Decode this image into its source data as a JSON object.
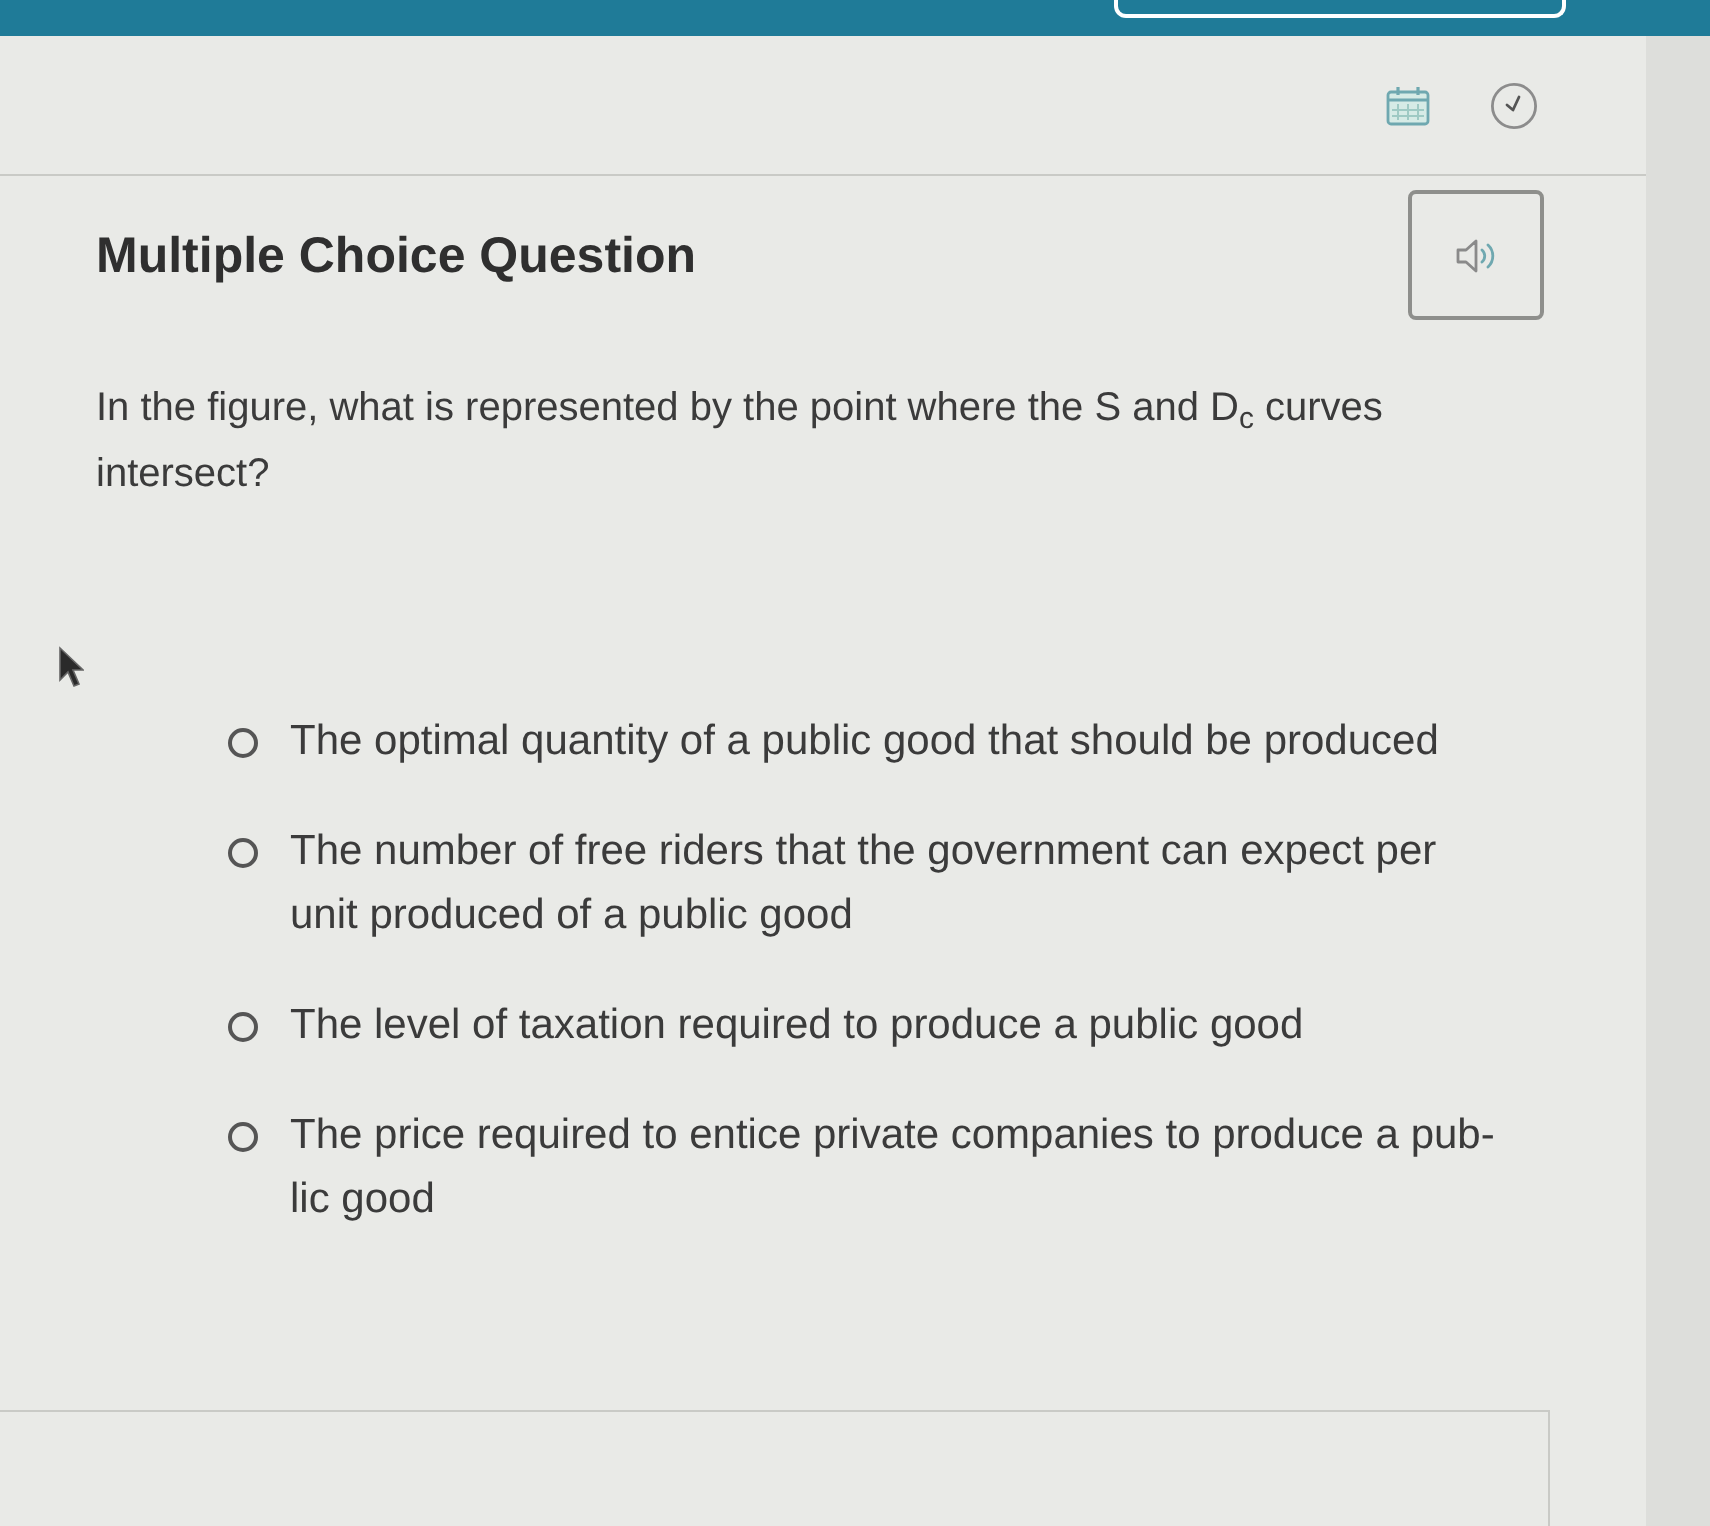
{
  "question": {
    "type_label": "Multiple Choice Question",
    "prompt": "In the figure, what is represented by the point where the S and D$_{c}$ curves intersect?",
    "options": [
      {
        "text": "The optimal quantity of a public good that should be produced",
        "selected": false
      },
      {
        "text": "The number of free riders that the government can expect per unit produced of a public good",
        "selected": false
      },
      {
        "text": "The level of taxation required to produce a public good",
        "selected": false
      },
      {
        "text": "The price required to entice private companies to produce a pub-lic good",
        "selected": false
      }
    ]
  }
}
